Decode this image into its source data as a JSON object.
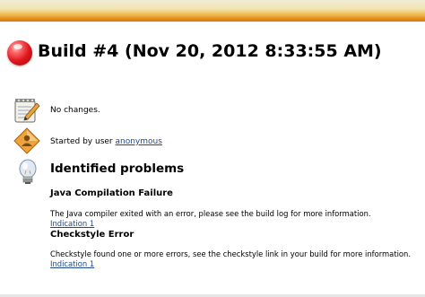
{
  "header": {
    "status_icon": "red-ball-icon",
    "title": "Build #4 (Nov 20, 2012 8:33:55 AM)"
  },
  "changes": {
    "icon": "notepad-icon",
    "text": "No changes."
  },
  "cause": {
    "icon": "user-icon",
    "prefix": "Started by user ",
    "user_link": "anonymous"
  },
  "problems": {
    "icon": "lightbulb-icon",
    "heading": "Identified problems",
    "items": [
      {
        "title": "Java Compilation Failure",
        "description": "The Java compiler exited with an error, please see the build log for more information.",
        "link": "Indication 1"
      },
      {
        "title": "Checkstyle Error",
        "description": "Checkstyle found one or more errors, see the checkstyle link in your build for more information.",
        "link": "Indication 1"
      }
    ]
  },
  "colors": {
    "band_top": "#f2e5b0",
    "band_bottom": "#d97a12",
    "status_red": "#e0151c",
    "link": "#204a87"
  }
}
